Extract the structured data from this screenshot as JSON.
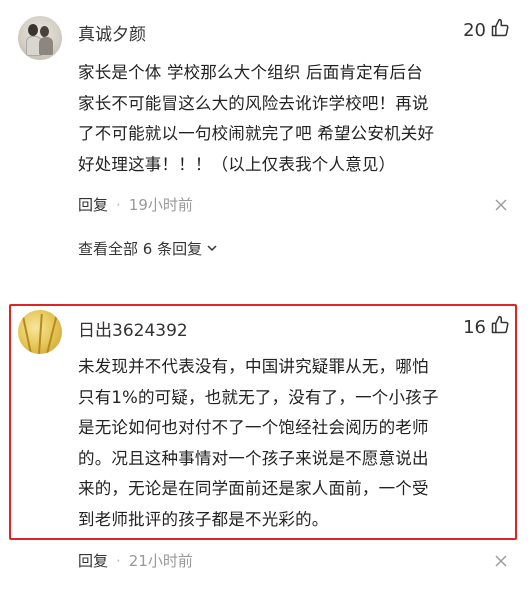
{
  "comments": [
    {
      "username": "真诚夕颜",
      "likes": "20",
      "content_lines": [
        "家长是个体 学校那么大个组织 后面肯定有后台",
        "家长不可能冒这么大的风险去讹诈学校吧！再说",
        "了不可能就以一句校闹就完了吧 希望公安机关好",
        "好处理这事！！！（以上仅表我个人意见）"
      ],
      "reply_label": "回复",
      "time": "19小时前",
      "view_all": "查看全部 6 条回复"
    },
    {
      "username": "日出3624392",
      "likes": "16",
      "content_lines": [
        "未发现并不代表没有，中国讲究疑罪从无，哪怕",
        "只有1%的可疑，也就无了，没有了，一个小孩子",
        "是无论如何也对付不了一个饱经社会阅历的老师",
        "的。况且这种事情对一个孩子来说是不愿意说出",
        "来的，无论是在同学面前还是家人面前，一个受",
        "到老师批评的孩子都是不光彩的。"
      ],
      "reply_label": "回复",
      "time": "21小时前"
    }
  ],
  "icons": {
    "like": "thumbs-up-icon",
    "close": "close-icon",
    "chevron": "chevron-down-icon"
  },
  "colors": {
    "highlight": "#e02424",
    "meta_text": "#999999"
  }
}
